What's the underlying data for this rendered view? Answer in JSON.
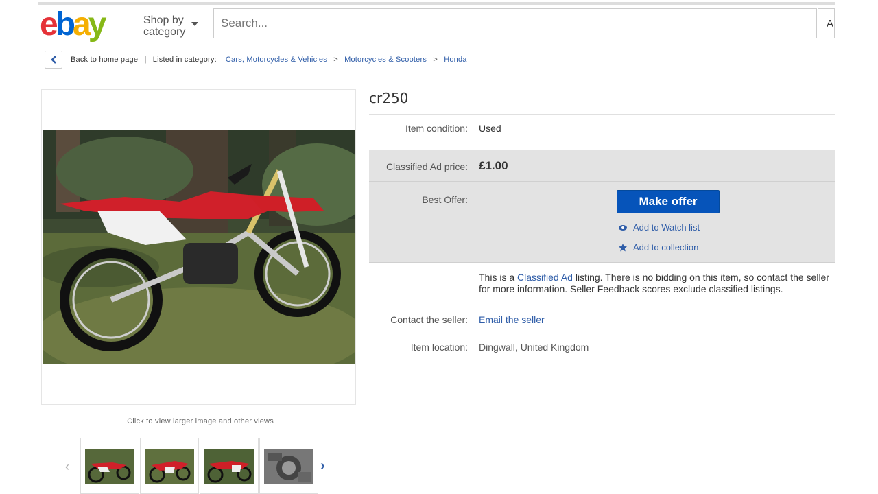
{
  "header": {
    "logo_letters": [
      "e",
      "b",
      "a",
      "y"
    ],
    "logo_colors": [
      "#e53238",
      "#0064d2",
      "#f5af02",
      "#86b817"
    ],
    "shop_by_line1": "Shop by",
    "shop_by_line2": "category",
    "search_placeholder": "Search...",
    "search_category_label": "A"
  },
  "breadcrumb": {
    "back_label": "Back to home page",
    "listed_label": "Listed in category:",
    "items": [
      "Cars, Motorcycles & Vehicles",
      "Motorcycles & Scooters",
      "Honda"
    ],
    "separator": ">"
  },
  "gallery": {
    "caption": "Click to view larger image and other views",
    "thumb_count": 4
  },
  "listing": {
    "title": "cr250",
    "condition_label": "Item condition:",
    "condition_value": "Used",
    "price_label": "Classified Ad price:",
    "price_value": "£1.00",
    "best_offer_label": "Best Offer:",
    "make_offer_label": "Make offer",
    "watch_label": "Add to Watch list",
    "collection_label": "Add to collection",
    "info_prefix": "This is a ",
    "info_link": "Classified Ad",
    "info_suffix": " listing. There is no bidding on this item, so contact the seller for more information. Seller Feedback scores exclude classified listings.",
    "contact_label": "Contact the seller:",
    "contact_link": "Email the seller",
    "location_label": "Item location:",
    "location_value": "Dingwall, United Kingdom"
  },
  "colors": {
    "link": "#2f5da8",
    "button": "#0654ba",
    "band": "#e3e3e3"
  }
}
